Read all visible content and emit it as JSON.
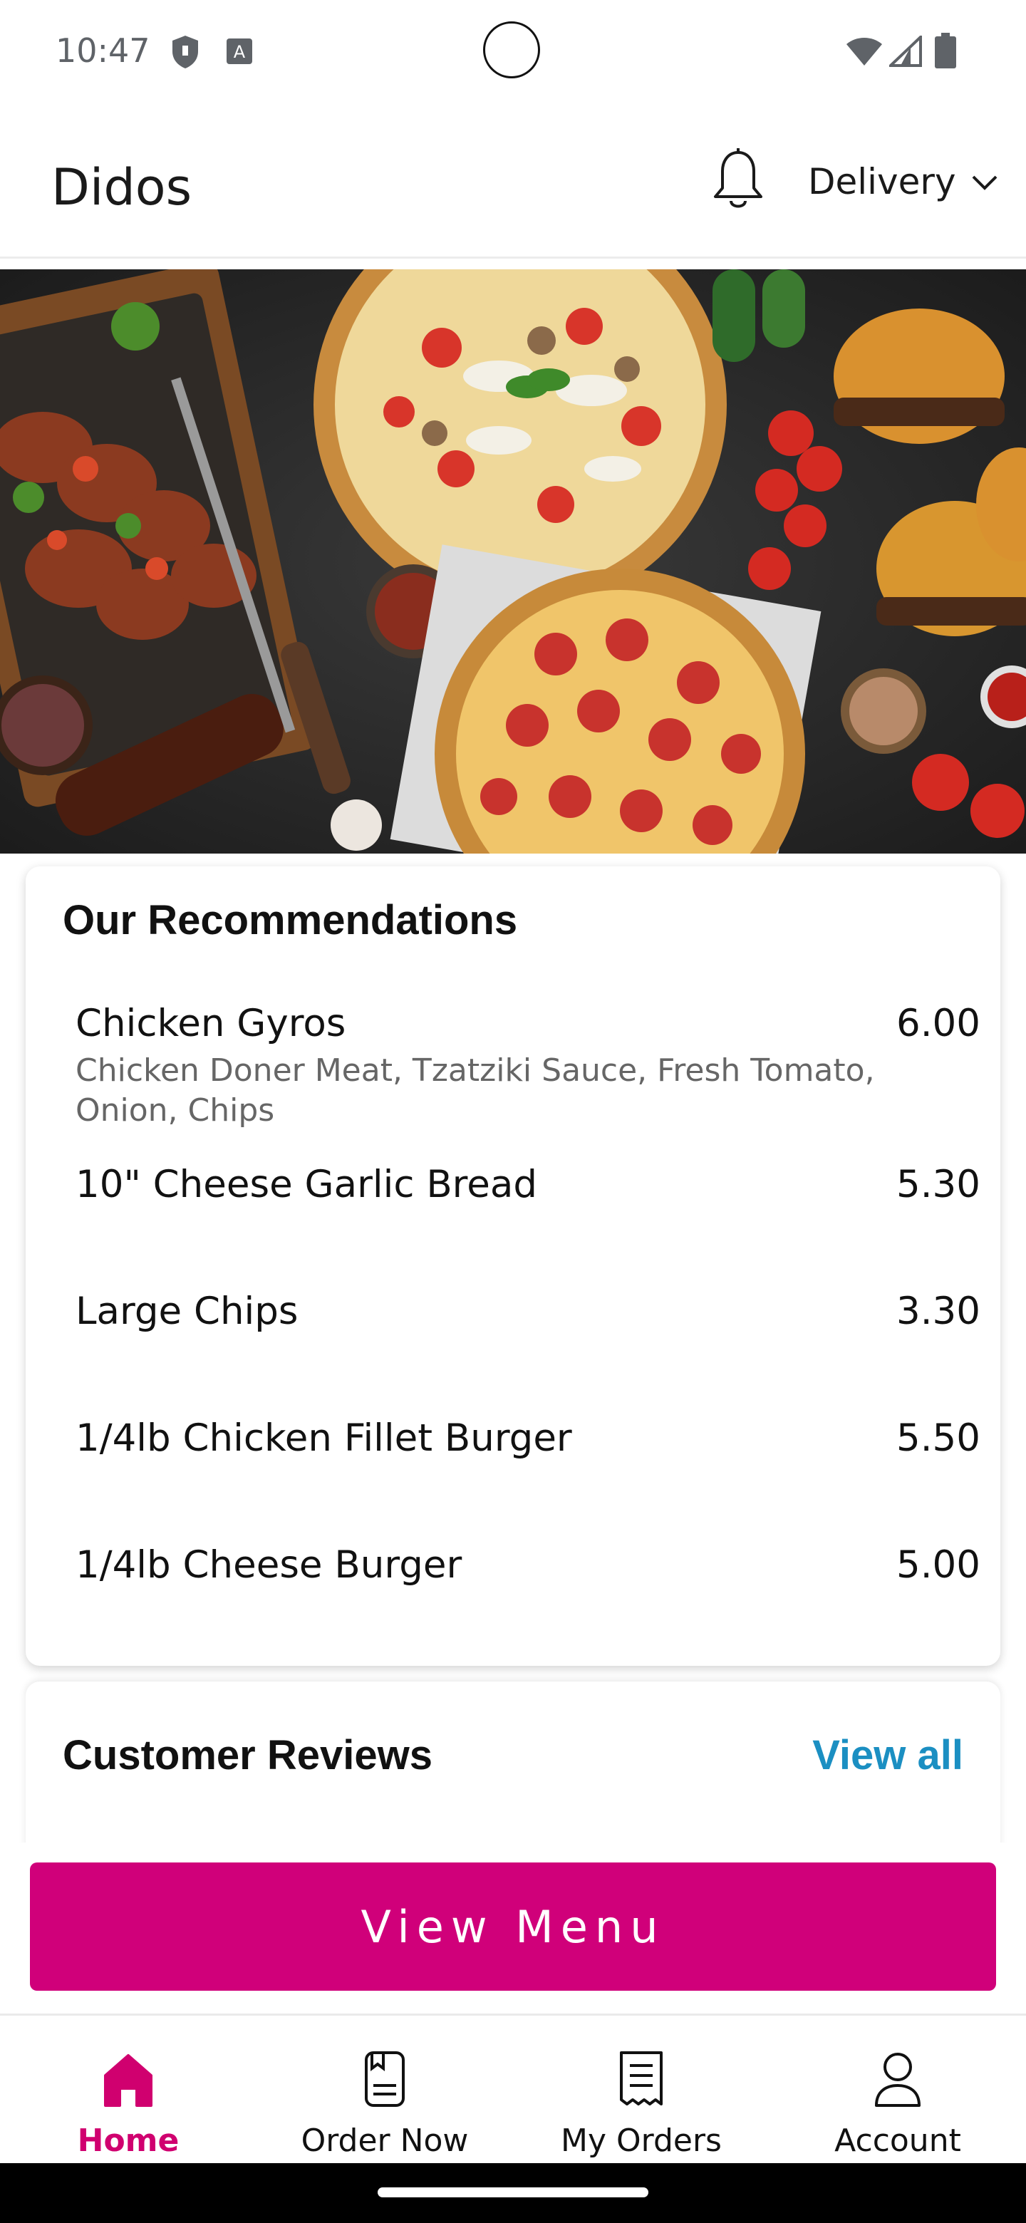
{
  "status_bar": {
    "time": "10:47"
  },
  "header": {
    "title": "Didos",
    "delivery_label": "Delivery"
  },
  "recommendations": {
    "title": "Our Recommendations",
    "items": [
      {
        "name": "Chicken Gyros",
        "price": "6.00",
        "description": "Chicken Doner Meat, Tzatziki Sauce, Fresh Tomato, Onion, Chips"
      },
      {
        "name": "10\" Cheese Garlic Bread",
        "price": "5.30"
      },
      {
        "name": "Large Chips",
        "price": "3.30"
      },
      {
        "name": "1/4lb Chicken Fillet Burger",
        "price": "5.50"
      },
      {
        "name": "1/4lb Cheese Burger",
        "price": "5.00"
      }
    ]
  },
  "reviews": {
    "title": "Customer Reviews",
    "view_all": "View all"
  },
  "view_menu_label": "View Menu",
  "bottom_nav": {
    "items": [
      {
        "label": "Home",
        "icon": "home-icon",
        "active": true
      },
      {
        "label": "Order Now",
        "icon": "menu-book-icon",
        "active": false
      },
      {
        "label": "My Orders",
        "icon": "receipt-icon",
        "active": false
      },
      {
        "label": "Account",
        "icon": "account-icon",
        "active": false
      }
    ]
  },
  "colors": {
    "accent": "#d0007a",
    "link": "#1b8fc2"
  }
}
